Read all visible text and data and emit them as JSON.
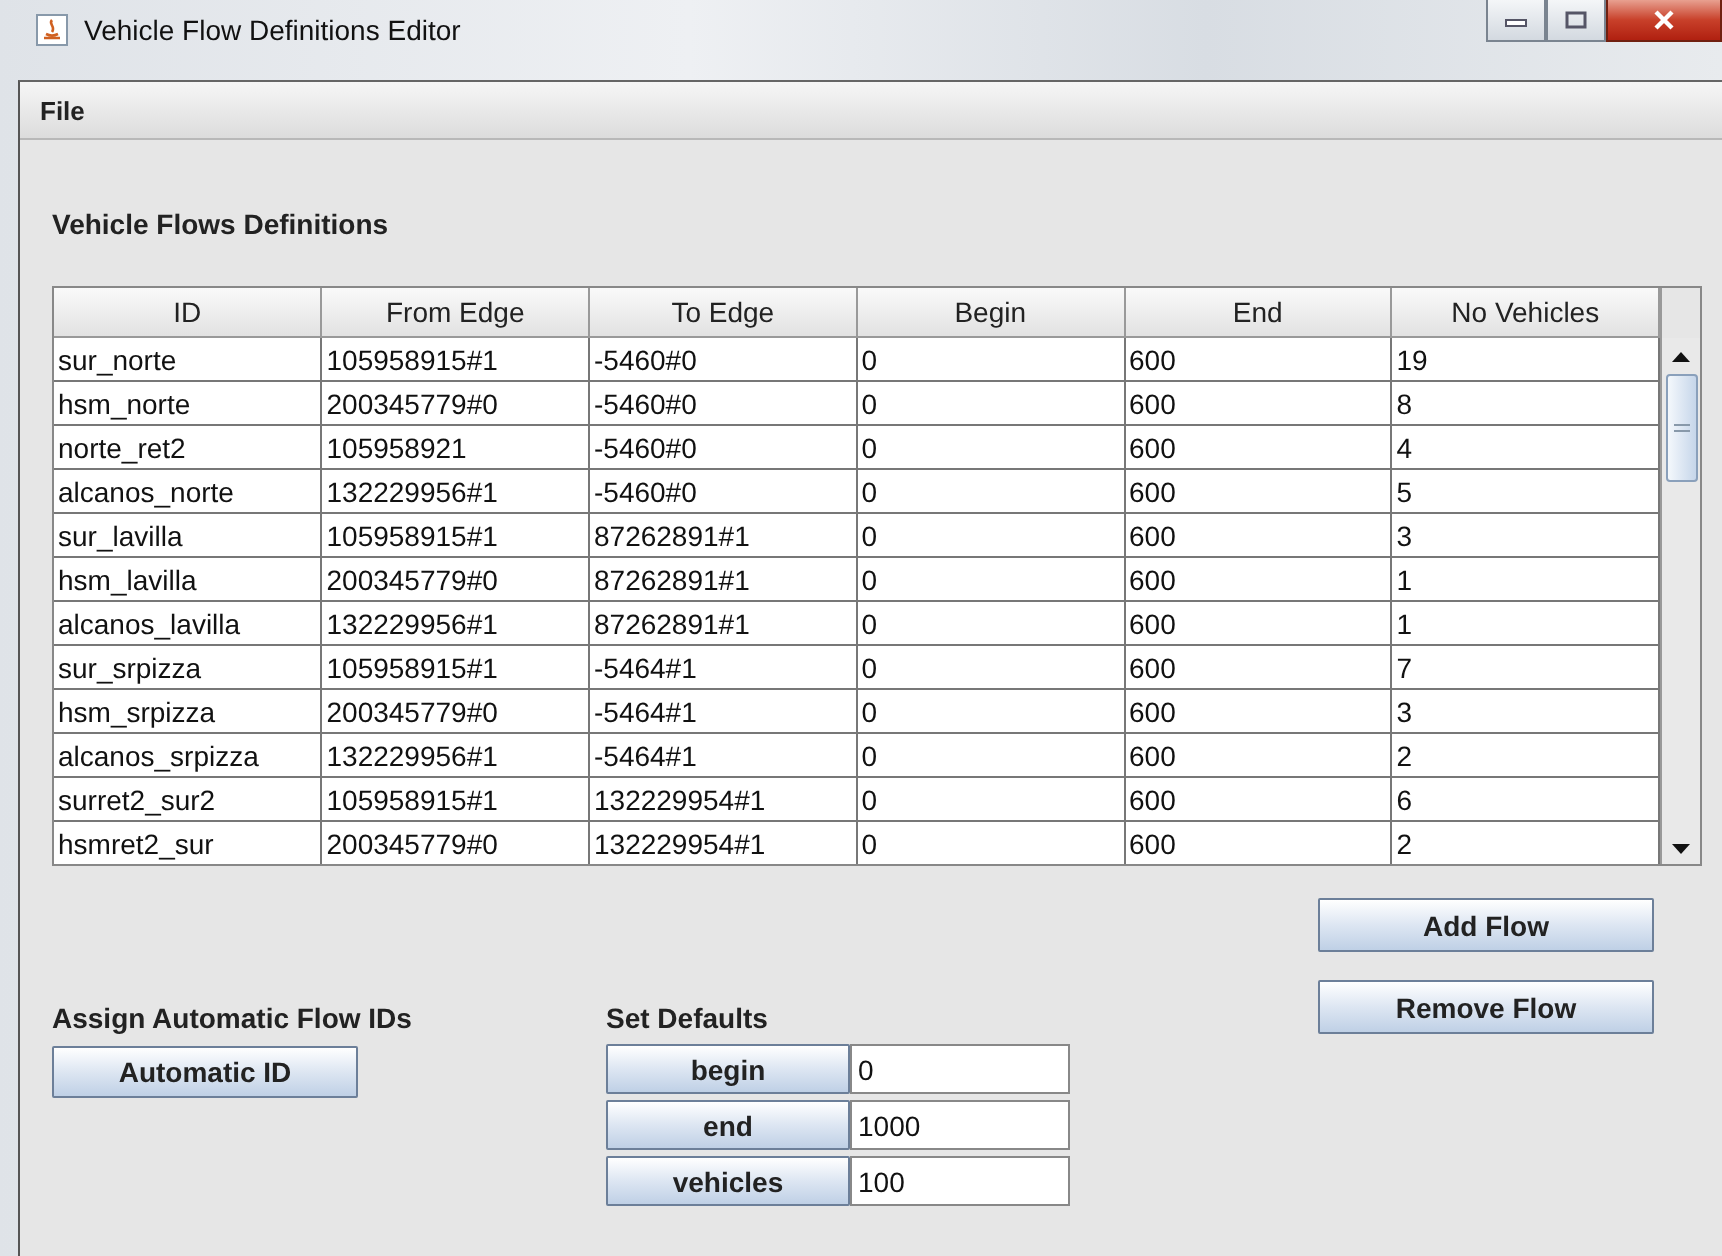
{
  "window": {
    "title": "Vehicle Flow Definitions Editor"
  },
  "menu": [
    {
      "label": "File"
    }
  ],
  "section_title": "Vehicle Flows Definitions",
  "table": {
    "columns": [
      "ID",
      "From Edge",
      "To Edge",
      "Begin",
      "End",
      "No Vehicles"
    ],
    "rows": [
      [
        "sur_norte",
        "105958915#1",
        "-5460#0",
        "0",
        "600",
        "19"
      ],
      [
        "hsm_norte",
        "200345779#0",
        "-5460#0",
        "0",
        "600",
        "8"
      ],
      [
        "norte_ret2",
        "105958921",
        "-5460#0",
        "0",
        "600",
        "4"
      ],
      [
        "alcanos_norte",
        "132229956#1",
        "-5460#0",
        "0",
        "600",
        "5"
      ],
      [
        "sur_lavilla",
        "105958915#1",
        "87262891#1",
        "0",
        "600",
        "3"
      ],
      [
        "hsm_lavilla",
        "200345779#0",
        "87262891#1",
        "0",
        "600",
        "1"
      ],
      [
        "alcanos_lavilla",
        "132229956#1",
        "87262891#1",
        "0",
        "600",
        "1"
      ],
      [
        "sur_srpizza",
        "105958915#1",
        "-5464#1",
        "0",
        "600",
        "7"
      ],
      [
        "hsm_srpizza",
        "200345779#0",
        "-5464#1",
        "0",
        "600",
        "3"
      ],
      [
        "alcanos_srpizza",
        "132229956#1",
        "-5464#1",
        "0",
        "600",
        "2"
      ],
      [
        "surret2_sur2",
        "105958915#1",
        "132229954#1",
        "0",
        "600",
        "6"
      ],
      [
        "hsmret2_sur",
        "200345779#0",
        "132229954#1",
        "0",
        "600",
        "2"
      ]
    ]
  },
  "auto_ids": {
    "title": "Assign Automatic Flow IDs",
    "button": "Automatic ID"
  },
  "defaults": {
    "title": "Set Defaults",
    "fields": [
      {
        "button": "begin",
        "value": "0"
      },
      {
        "button": "end",
        "value": "1000"
      },
      {
        "button": "vehicles",
        "value": "100"
      }
    ]
  },
  "actions": [
    "Add Flow",
    "Remove Flow"
  ]
}
